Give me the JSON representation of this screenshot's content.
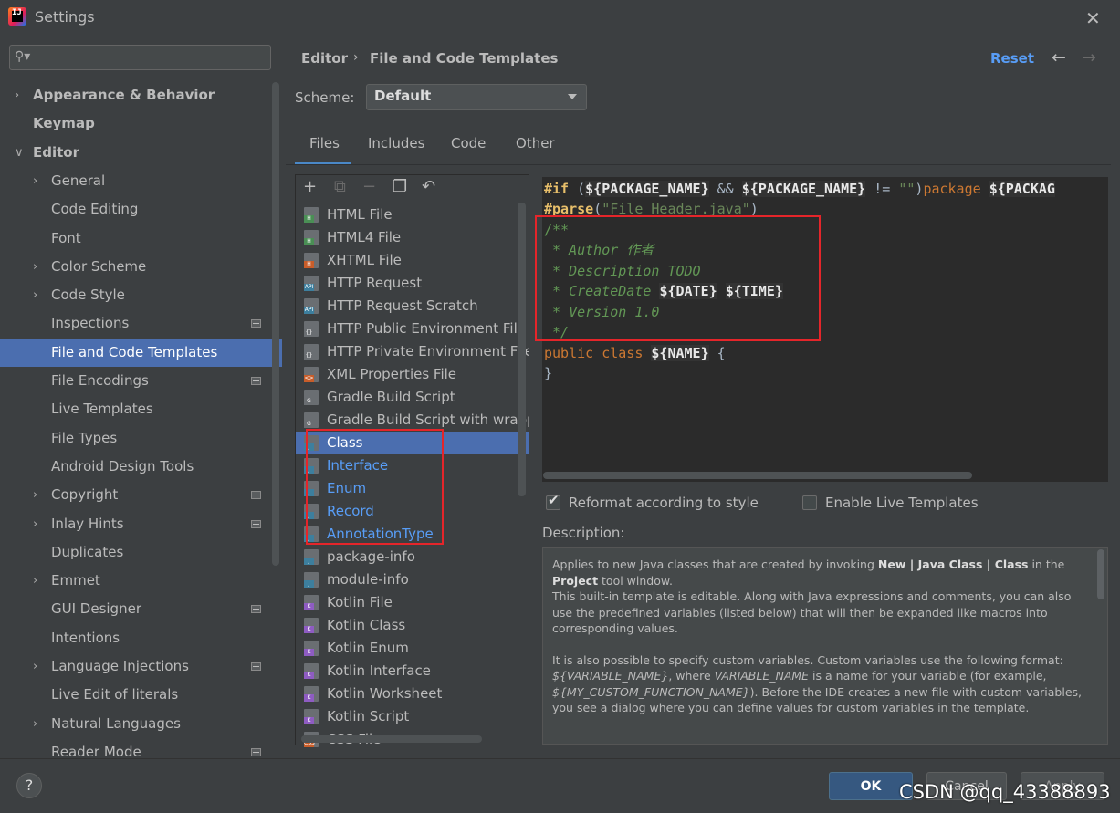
{
  "window": {
    "title": "Settings",
    "app_icon_text": "IJ"
  },
  "search": {
    "placeholder": ""
  },
  "nav": [
    {
      "label": "Appearance & Behavior",
      "level": 0,
      "expander": true,
      "bold": true,
      "gear": false
    },
    {
      "label": "Keymap",
      "level": 0,
      "expander": false,
      "bold": true,
      "gear": false
    },
    {
      "label": "Editor",
      "level": 0,
      "expander": true,
      "expanded": true,
      "bold": true,
      "gear": false
    },
    {
      "label": "General",
      "level": 1,
      "expander": true,
      "gear": false
    },
    {
      "label": "Code Editing",
      "level": 1,
      "expander": false,
      "gear": false
    },
    {
      "label": "Font",
      "level": 1,
      "expander": false,
      "gear": false
    },
    {
      "label": "Color Scheme",
      "level": 1,
      "expander": true,
      "gear": false
    },
    {
      "label": "Code Style",
      "level": 1,
      "expander": true,
      "gear": false
    },
    {
      "label": "Inspections",
      "level": 1,
      "expander": false,
      "gear": true
    },
    {
      "label": "File and Code Templates",
      "level": 1,
      "expander": false,
      "gear": false,
      "selected": true
    },
    {
      "label": "File Encodings",
      "level": 1,
      "expander": false,
      "gear": true
    },
    {
      "label": "Live Templates",
      "level": 1,
      "expander": false,
      "gear": false
    },
    {
      "label": "File Types",
      "level": 1,
      "expander": false,
      "gear": false
    },
    {
      "label": "Android Design Tools",
      "level": 1,
      "expander": false,
      "gear": false
    },
    {
      "label": "Copyright",
      "level": 1,
      "expander": true,
      "gear": true
    },
    {
      "label": "Inlay Hints",
      "level": 1,
      "expander": true,
      "gear": true
    },
    {
      "label": "Duplicates",
      "level": 1,
      "expander": false,
      "gear": false
    },
    {
      "label": "Emmet",
      "level": 1,
      "expander": true,
      "gear": false
    },
    {
      "label": "GUI Designer",
      "level": 1,
      "expander": false,
      "gear": true
    },
    {
      "label": "Intentions",
      "level": 1,
      "expander": false,
      "gear": false
    },
    {
      "label": "Language Injections",
      "level": 1,
      "expander": true,
      "gear": true
    },
    {
      "label": "Live Edit of literals",
      "level": 1,
      "expander": false,
      "gear": false
    },
    {
      "label": "Natural Languages",
      "level": 1,
      "expander": true,
      "gear": false
    },
    {
      "label": "Reader Mode",
      "level": 1,
      "expander": false,
      "gear": true
    }
  ],
  "breadcrumb": {
    "parent": "Editor",
    "separator": "›",
    "current": "File and Code Templates"
  },
  "header": {
    "reset_label": "Reset",
    "back_icon": "←",
    "forward_icon": "→"
  },
  "scheme": {
    "label": "Scheme:",
    "value": "Default"
  },
  "tabs": [
    {
      "label": "Files",
      "active": true
    },
    {
      "label": "Includes"
    },
    {
      "label": "Code"
    },
    {
      "label": "Other"
    }
  ],
  "toolbar": {
    "add": "+",
    "copy_plus": "⧉",
    "remove": "−",
    "duplicate": "❐",
    "reset": "↶"
  },
  "templates": [
    {
      "label": "HTML File",
      "badge": "H",
      "badge_color": "#4a8f55"
    },
    {
      "label": "HTML4 File",
      "badge": "H",
      "badge_color": "#4a8f55"
    },
    {
      "label": "XHTML File",
      "badge": "H",
      "badge_color": "#c85d2a"
    },
    {
      "label": "HTTP Request",
      "badge": "API",
      "badge_color": "#3d7f9e"
    },
    {
      "label": "HTTP Request Scratch",
      "badge": "API",
      "badge_color": "#3d7f9e"
    },
    {
      "label": "HTTP Public Environment File",
      "badge": "{}",
      "badge_color": "#6a6e72"
    },
    {
      "label": "HTTP Private Environment File",
      "badge": "{}",
      "badge_color": "#6a6e72"
    },
    {
      "label": "XML Properties File",
      "badge": "<>",
      "badge_color": "#c85d2a"
    },
    {
      "label": "Gradle Build Script",
      "badge": "G",
      "badge_color": "#6a6e72"
    },
    {
      "label": "Gradle Build Script with wrapper",
      "badge": "G",
      "badge_color": "#6a6e72"
    },
    {
      "label": "Class",
      "badge": "J",
      "badge_color": "#3d7f9e",
      "selected": true
    },
    {
      "label": "Interface",
      "badge": "J",
      "badge_color": "#3d7f9e",
      "blue": true
    },
    {
      "label": "Enum",
      "badge": "J",
      "badge_color": "#3d7f9e",
      "blue": true
    },
    {
      "label": "Record",
      "badge": "J",
      "badge_color": "#3d7f9e",
      "blue": true
    },
    {
      "label": "AnnotationType",
      "badge": "J",
      "badge_color": "#3d7f9e",
      "blue": true
    },
    {
      "label": "package-info",
      "badge": "J",
      "badge_color": "#3d7f9e"
    },
    {
      "label": "module-info",
      "badge": "J",
      "badge_color": "#3d7f9e"
    },
    {
      "label": "Kotlin File",
      "badge": "K",
      "badge_color": "#8e5cc2"
    },
    {
      "label": "Kotlin Class",
      "badge": "K",
      "badge_color": "#8e5cc2"
    },
    {
      "label": "Kotlin Enum",
      "badge": "K",
      "badge_color": "#8e5cc2"
    },
    {
      "label": "Kotlin Interface",
      "badge": "K",
      "badge_color": "#8e5cc2"
    },
    {
      "label": "Kotlin Worksheet",
      "badge": "K",
      "badge_color": "#8e5cc2"
    },
    {
      "label": "Kotlin Script",
      "badge": "K",
      "badge_color": "#8e5cc2"
    },
    {
      "label": "CSS File",
      "badge": "CSS",
      "badge_color": "#c85d2a"
    }
  ],
  "code": {
    "l1_if": "#if",
    "l1_open": " (",
    "l1_v1": "${PACKAGE_NAME}",
    "l1_and": " && ",
    "l1_v2": "${PACKAGE_NAME}",
    "l1_ne": " != ",
    "l1_str": "\"\"",
    "l1_close": ")",
    "l1_pkg": "package ",
    "l1_v3": "${PACKAG",
    "l2_parse": "#parse",
    "l2_open": "(",
    "l2_str": "\"File Header.java\"",
    "l2_close": ")",
    "l3": "/**",
    "l4": " * Author 作者",
    "l5": " * Description TODO",
    "l6_a": " * CreateDate ",
    "l6_v1": "${DATE}",
    "l6_sp": " ",
    "l6_v2": "${TIME}",
    "l7": " * Version 1.0",
    "l8": " */",
    "l9_kw": "public class ",
    "l9_v": "${NAME}",
    "l9_br": " {",
    "l10": "}"
  },
  "options": {
    "reformat_label": "Reformat according to style",
    "reformat_checked": true,
    "live_label": "Enable Live Templates",
    "live_checked": false
  },
  "description": {
    "label": "Description:",
    "p1_a": "Applies to new Java classes that are created by invoking ",
    "p1_b": "New | Java Class | Class",
    "p1_c": " in the ",
    "p1_d": "Project",
    "p1_e": " tool window.",
    "p2": "This built-in template is editable. Along with Java expressions and comments, you can also use the predefined variables (listed below) that will then be expanded like macros into corresponding values.",
    "p3_a": "It is also possible to specify custom variables. Custom variables use the following format: ",
    "p3_b": "${VARIABLE_NAME}",
    "p3_c": ", where ",
    "p3_d": "VARIABLE_NAME",
    "p3_e": " is a name for your variable (for example, ",
    "p3_f": "${MY_CUSTOM_FUNCTION_NAME}",
    "p3_g": "). Before the IDE creates a new file with custom variables, you see a dialog where you can define values for custom variables in the template."
  },
  "footer": {
    "help": "?",
    "ok": "OK",
    "cancel": "Cancel",
    "apply": "Apply"
  },
  "watermark": "CSDN @qq_43388893"
}
